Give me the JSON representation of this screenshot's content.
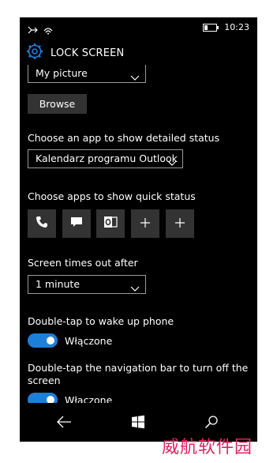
{
  "status_bar": {
    "time": "10:23",
    "battery_level": 0.25,
    "icons": [
      "cellular-icon",
      "wifi-icon",
      "battery-icon"
    ]
  },
  "header": {
    "title": "LOCK SCREEN",
    "icon": "gear-icon"
  },
  "background": {
    "selected": "My picture",
    "browse_label": "Browse"
  },
  "detailed_status": {
    "label": "Choose an app to show detailed status",
    "selected": "Kalendarz programu Outlook"
  },
  "quick_status": {
    "label": "Choose apps to show quick status",
    "slots": [
      "phone-icon",
      "message-icon",
      "outlook-icon",
      "plus-icon",
      "plus-icon"
    ]
  },
  "timeout": {
    "label": "Screen times out after",
    "selected": "1 minute"
  },
  "double_tap_wake": {
    "label": "Double-tap to wake up phone",
    "state": "Włączone",
    "on": true
  },
  "double_tap_off": {
    "label": "Double-tap the navigation bar to turn off the screen",
    "state": "Włączone",
    "on": true
  },
  "nav_bar": {
    "icons": [
      "back-icon",
      "windows-icon",
      "search-icon"
    ]
  },
  "footer": {
    "text": "威航软件园"
  },
  "colors": {
    "accent": "#1e7fd9",
    "tile": "#333333",
    "footer_text": "#e0245e"
  }
}
